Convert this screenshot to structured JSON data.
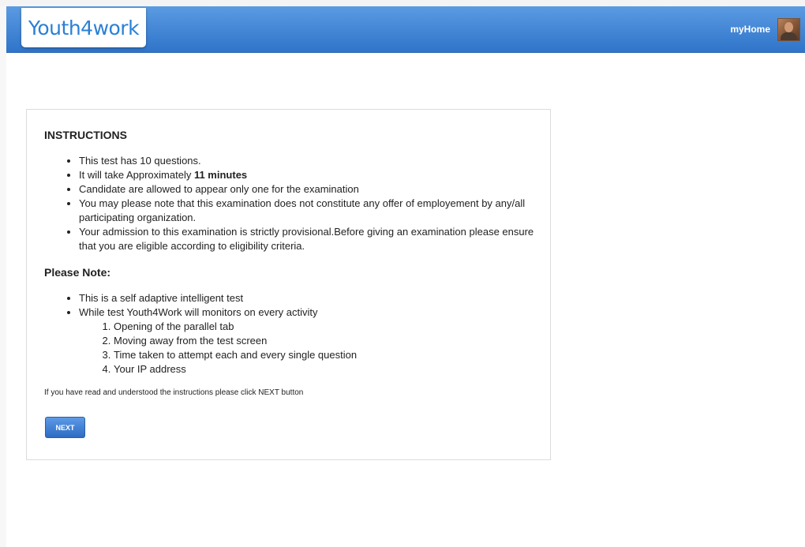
{
  "header": {
    "logo_text": "Youth4work",
    "myhome_label": "myHome",
    "colors": {
      "bar_top": "#5b9be3",
      "bar_bottom": "#2f74c9",
      "logo": "#2a80d6"
    }
  },
  "instructions": {
    "title": "INSTRUCTIONS",
    "items": [
      "This test has 10  questions.",
      {
        "prefix": "It will take Approximately ",
        "bold": "11  minutes"
      },
      "Candidate are allowed to appear only one for the examination",
      "You may please note that this examination does not constitute any offer of employement by any/all participating organization.",
      "Your admission to this examination is strictly provisional.Before giving an examination please ensure that you are eligible according to eligibility criteria."
    ]
  },
  "note": {
    "title": "Please Note:",
    "items": [
      "This is a self adaptive intelligent test",
      "While test Youth4Work will monitors on every activity"
    ],
    "sub_items": [
      "Opening of the parallel tab",
      "Moving away from the test screen",
      "Time taken to attempt each and every single question",
      "Your IP address"
    ]
  },
  "footnote": "If you have read and understood the instructions please click NEXT button",
  "next_button": "NEXT",
  "icons": {
    "avatar": "user-avatar-icon"
  }
}
